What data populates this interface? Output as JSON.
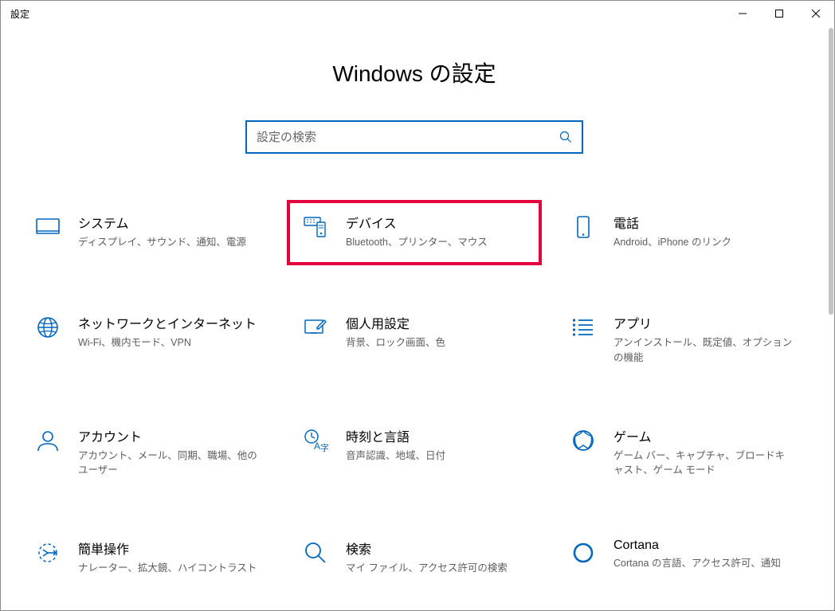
{
  "window": {
    "title": "設定"
  },
  "page": {
    "heading": "Windows の設定"
  },
  "search": {
    "placeholder": "設定の検索"
  },
  "tiles": [
    {
      "key": "system",
      "title": "システム",
      "subtitle": "ディスプレイ、サウンド、通知、電源"
    },
    {
      "key": "devices",
      "title": "デバイス",
      "subtitle": "Bluetooth、プリンター、マウス"
    },
    {
      "key": "phone",
      "title": "電話",
      "subtitle": "Android、iPhone のリンク"
    },
    {
      "key": "network",
      "title": "ネットワークとインターネット",
      "subtitle": "Wi-Fi、機内モード、VPN"
    },
    {
      "key": "personalization",
      "title": "個人用設定",
      "subtitle": "背景、ロック画面、色"
    },
    {
      "key": "apps",
      "title": "アプリ",
      "subtitle": "アンインストール、既定値、オプションの機能"
    },
    {
      "key": "accounts",
      "title": "アカウント",
      "subtitle": "アカウント、メール、同期、職場、他のユーザー"
    },
    {
      "key": "time",
      "title": "時刻と言語",
      "subtitle": "音声認識、地域、日付"
    },
    {
      "key": "gaming",
      "title": "ゲーム",
      "subtitle": "ゲーム バー、キャプチャ、ブロードキャスト、ゲーム モード"
    },
    {
      "key": "ease",
      "title": "簡単操作",
      "subtitle": "ナレーター、拡大鏡、ハイコントラスト"
    },
    {
      "key": "search",
      "title": "検索",
      "subtitle": "マイ ファイル、アクセス許可の検索"
    },
    {
      "key": "cortana",
      "title": "Cortana",
      "subtitle": "Cortana の言語、アクセス許可、通知"
    }
  ]
}
